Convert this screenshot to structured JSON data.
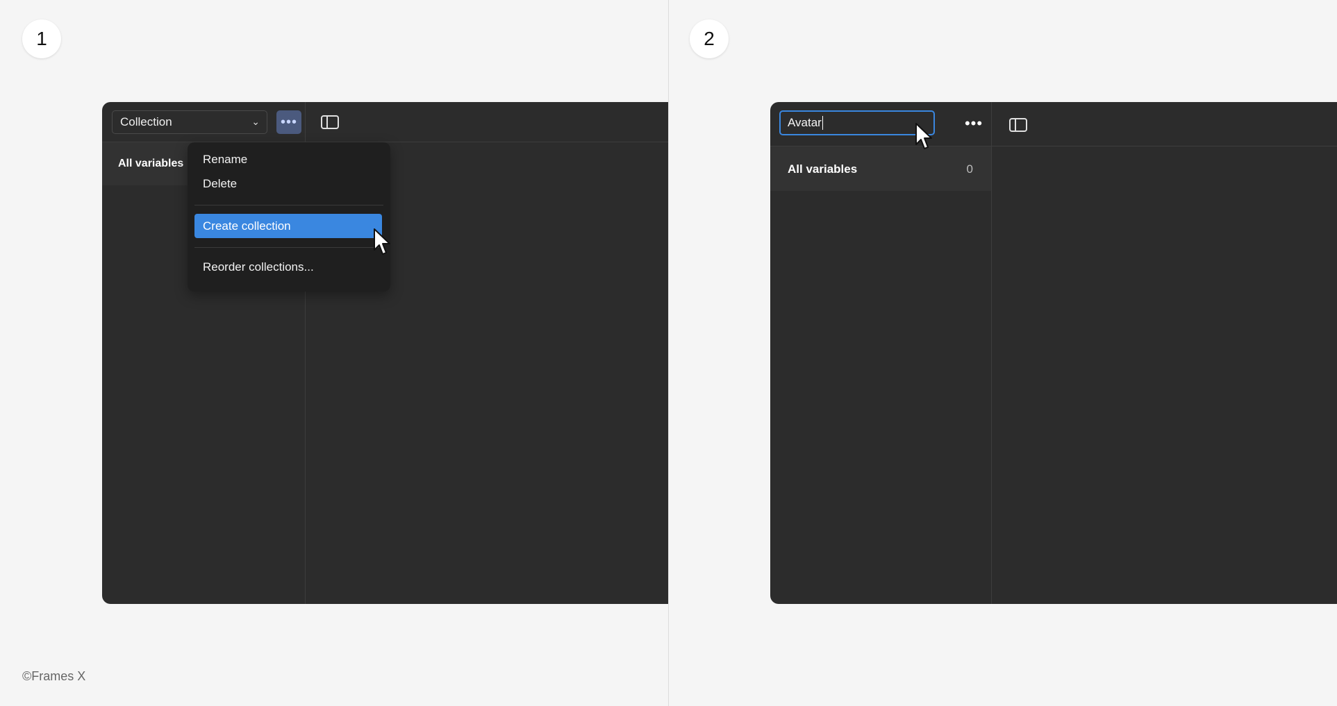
{
  "steps": [
    "1",
    "2"
  ],
  "panel1": {
    "collection_select": {
      "value": "Collection",
      "chevron": "chevron-down-icon"
    },
    "more_button": {
      "icon": "more-horizontal-icon",
      "glyph": "•••"
    },
    "panel_toggle_icon": "sidebar-toggle-icon",
    "sidebar": {
      "all_variables_label": "All variables"
    },
    "menu": {
      "items": [
        "Rename",
        "Delete",
        "Create collection",
        "Reorder collections..."
      ],
      "active_index": 2
    }
  },
  "panel2": {
    "name_input": {
      "value": "Avatar"
    },
    "more_button": {
      "icon": "more-horizontal-icon",
      "glyph": "•••"
    },
    "panel_toggle_icon": "sidebar-toggle-icon",
    "sidebar": {
      "all_variables_label": "All variables",
      "count": "0"
    }
  },
  "footer": {
    "copyright": "©Frames X"
  },
  "colors": {
    "background": "#f5f5f5",
    "window": "#2c2c2c",
    "menu": "#1f1f1f",
    "accent": "#3a87e0",
    "more_button_active": "#4b5a7e"
  }
}
